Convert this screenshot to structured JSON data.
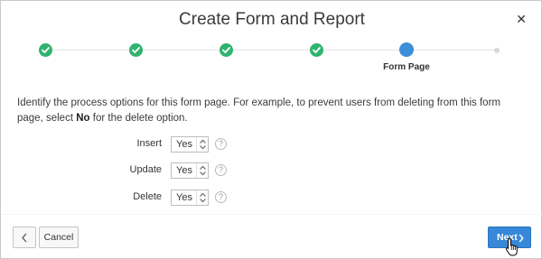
{
  "dialog": {
    "title": "Create Form and Report",
    "close_icon": "close-icon"
  },
  "wizard": {
    "steps": [
      {
        "state": "complete",
        "icon": "check-icon"
      },
      {
        "state": "complete",
        "icon": "check-icon"
      },
      {
        "state": "complete",
        "icon": "check-icon"
      },
      {
        "state": "complete",
        "icon": "check-icon"
      },
      {
        "state": "current",
        "label": "Form Page"
      },
      {
        "state": "future"
      }
    ],
    "colors": {
      "complete": "#2fb36f",
      "current": "#3d8ed8",
      "future": "#d8d8d8"
    }
  },
  "instructions": {
    "text_before": "Identify the process options for this form page. For example, to prevent users from deleting from this form page, select",
    "bold": "No",
    "text_after": "for the delete option."
  },
  "fields": [
    {
      "label": "Insert",
      "value": "Yes"
    },
    {
      "label": "Update",
      "value": "Yes"
    },
    {
      "label": "Delete",
      "value": "Yes"
    }
  ],
  "footer": {
    "prev_icon": "chevron-left-icon",
    "cancel_label": "Cancel",
    "next_label": "Next",
    "next_color": "#3788d8"
  }
}
